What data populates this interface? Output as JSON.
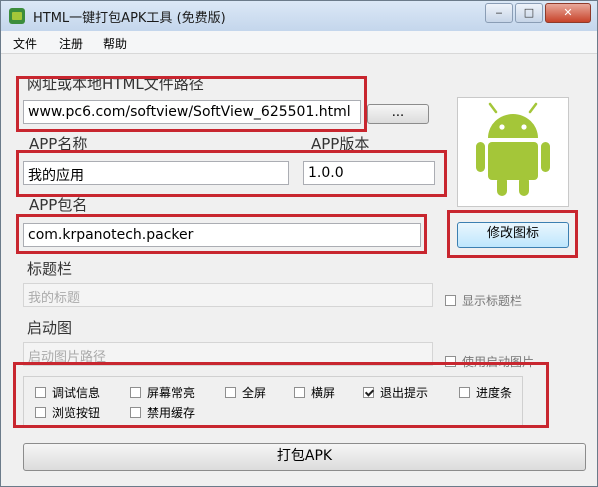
{
  "window": {
    "title": "HTML一键打包APK工具 (免费版)"
  },
  "menu": [
    "文件",
    "注册",
    "帮助"
  ],
  "url_section": {
    "label": "网址或本地HTML文件路径",
    "value": "www.pc6.com/softview/SoftView_625501.html",
    "browse_label": "..."
  },
  "app_name": {
    "label": "APP名称",
    "value": "我的应用"
  },
  "app_version": {
    "label": "APP版本",
    "value": "1.0.0"
  },
  "package": {
    "label": "APP包名",
    "value": "com.krpanotech.packer"
  },
  "change_icon_label": "修改图标",
  "titlebar_section": {
    "label": "标题栏",
    "placeholder": "我的标题",
    "checkbox_label": "显示标题栏"
  },
  "splash_section": {
    "label": "启动图",
    "placeholder": "启动图片路径",
    "checkbox_label": "使用启动图片"
  },
  "options": [
    {
      "label": "调试信息",
      "checked": false
    },
    {
      "label": "屏幕常亮",
      "checked": false
    },
    {
      "label": "全屏",
      "checked": false
    },
    {
      "label": "横屏",
      "checked": false
    },
    {
      "label": "退出提示",
      "checked": true
    },
    {
      "label": "进度条",
      "checked": false
    },
    {
      "label": "浏览按钮",
      "checked": false
    },
    {
      "label": "禁用缓存",
      "checked": false
    }
  ],
  "pack_button_label": "打包APK",
  "colors": {
    "highlight": "#c8262f",
    "android_green": "#a4c639"
  },
  "icons": {
    "app": "app-icon",
    "preview": "android-robot-icon"
  }
}
